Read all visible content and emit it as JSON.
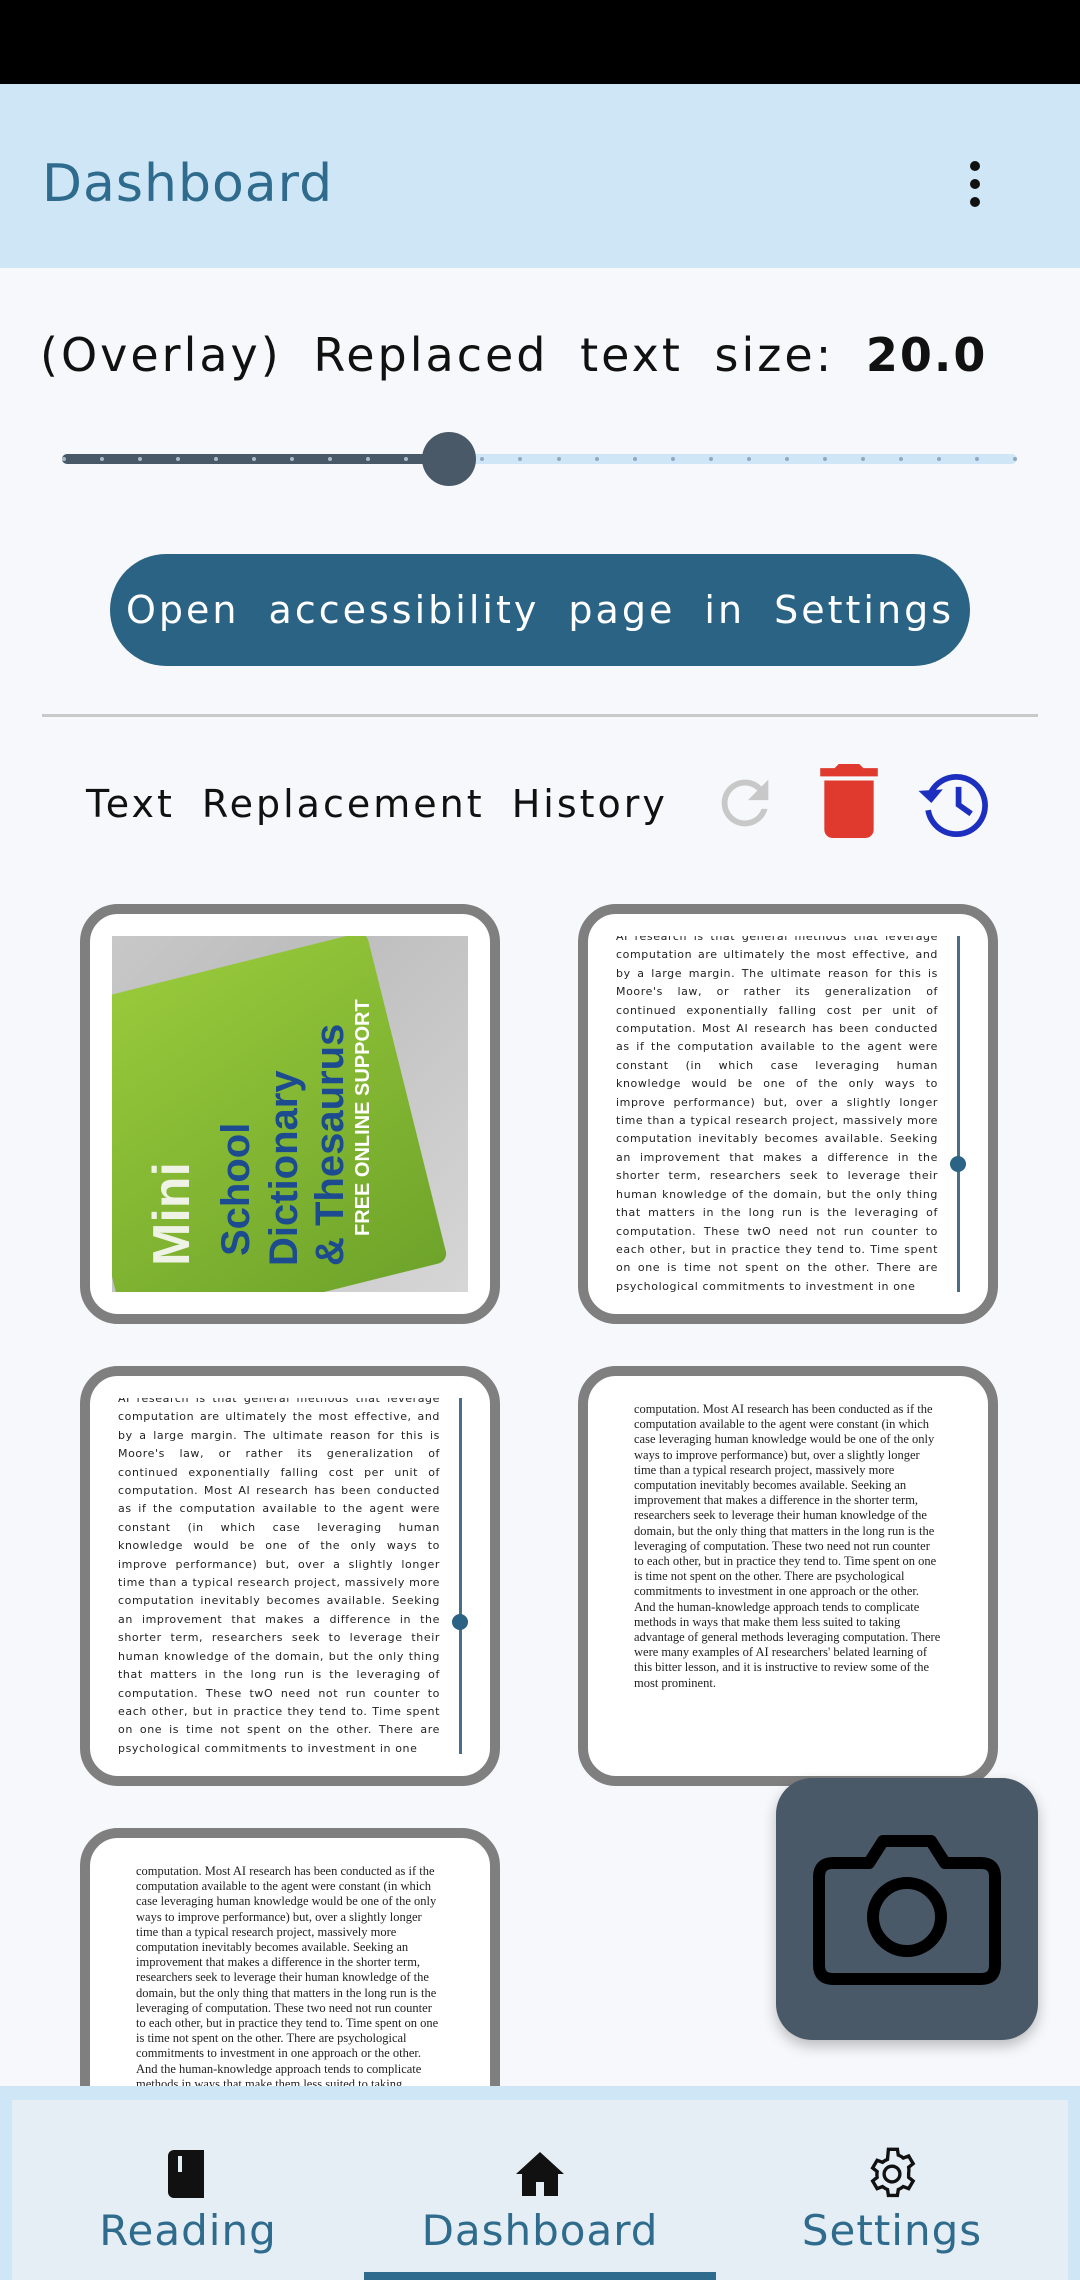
{
  "appbar": {
    "title": "Dashboard",
    "more_icon": "more-vert-icon"
  },
  "text_size": {
    "label": "(Overlay) Replaced text size:",
    "value": "20.0",
    "level_fraction": 0.405,
    "steps": 25
  },
  "accessibility_button": {
    "label": "Open accessibility page in Settings"
  },
  "history": {
    "title": "Text Replacement History",
    "refresh_icon": "refresh-icon",
    "delete_icon": "delete-icon",
    "history_icon": "history-icon"
  },
  "cards": {
    "photo": {
      "top": "Mini",
      "mid": "School",
      "line3": "Dictionary",
      "line4": "& Thesaurus",
      "support": "FREE ONLINE SUPPORT"
    },
    "doc_a": "AI research is that general methods that leverage computation are ultimately the most effective, and by a large margin. The ultimate reason for this is Moore's law, or rather its generalization of continued exponentially falling cost per unit of computation. Most AI research has been conducted as if the computation available to the agent were constant (in which case leveraging human knowledge would be one of the only ways to improve performance) but, over a slightly longer time than a typical research project, massively more computation inevitably becomes available. Seeking an improvement that makes a difference in the shorter term, researchers seek to leverage their human knowledge of the domain, but the only thing that matters in the long run is the leveraging of computation. These twO need not run counter to each other, but in practice they tend to. Time spent on one is time not spent on the other. There are psychological commitments to investment in one",
    "doc_b": "computation. Most AI research has been conducted as if the computation available to the agent were constant (in which case leveraging human knowledge would be one of the only ways to improve performance) but, over a slightly longer time than a typical research project, massively more computation inevitably becomes available. Seeking an improvement that makes a difference in the shorter term, researchers seek to leverage their human knowledge of the domain, but the only thing that matters in the long run is the leveraging of computation. These two need not run counter to each other, but in practice they tend to. Time spent on one is time not spent on the other. There are psychological commitments to investment in one approach or the other. And the human-knowledge approach tends to complicate methods in ways that make them less suited to taking advantage of general methods leveraging computation. There were many examples of AI researchers' belated learning of this bitter lesson, and it is instructive to review some of the most prominent."
  },
  "camera_fab": {
    "icon": "camera-icon"
  },
  "bottom_nav": {
    "items": [
      {
        "label": "Reading",
        "icon": "book-icon"
      },
      {
        "label": "Dashboard",
        "icon": "home-icon"
      },
      {
        "label": "Settings",
        "icon": "gear-icon"
      }
    ],
    "active": "Dashboard"
  },
  "colors": {
    "primary": "#2b6385",
    "appbar": "#cfe6f7",
    "delete": "#e03a2e",
    "history": "#1d2fbf",
    "slider": "#4a5968"
  }
}
